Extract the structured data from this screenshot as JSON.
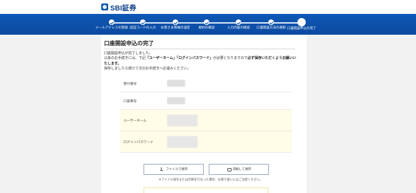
{
  "brand": {
    "logo_text": "SBI証券",
    "logo_icon": "sbi-logo-icon"
  },
  "progress": {
    "steps": [
      {
        "label": "メールアドレスの登録",
        "state": "done"
      },
      {
        "label": "認証コードの入力",
        "state": "done"
      },
      {
        "label": "お客さま情報の設定",
        "state": "done"
      },
      {
        "label": "規約の確認",
        "state": "done"
      },
      {
        "label": "入力内容の確認",
        "state": "done"
      },
      {
        "label": "口座開設方法の選択",
        "state": "done"
      },
      {
        "label": "口座開設申込の完了",
        "state": "current"
      }
    ],
    "accent_color": "#0f58b6"
  },
  "page": {
    "title": "口座開設申込の完了",
    "intro_1": "口座開設申込が完了しました。",
    "intro_2a": "以後のお手続きには、下記",
    "intro_2_strong": "「ユーザーネーム」「ログインパスワード」",
    "intro_2b": "が必要となりますので",
    "intro_2c": "必ず保存いただくようお願いいたします。",
    "intro_3": "保存しましたら続けて次のお手続きへお進みください。"
  },
  "details": [
    {
      "label": "受付番号",
      "value": ""
    },
    {
      "label": "口座番号",
      "value": ""
    },
    {
      "label": "ユーザーネーム",
      "value": ""
    },
    {
      "label": "ログインパスワード",
      "value": ""
    }
  ],
  "actions": {
    "save_file": "ファイルで保存",
    "print_save": "印刷して保存",
    "note": "※ファイル保存または印刷を行なった場合、お取り扱いにはご注意ください。"
  }
}
